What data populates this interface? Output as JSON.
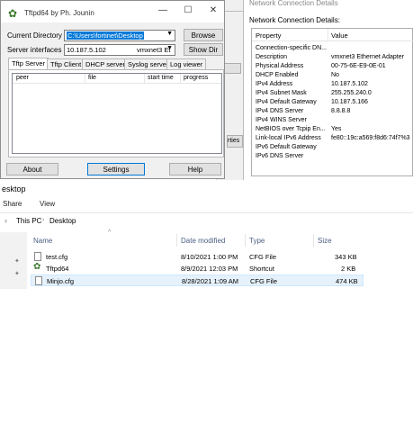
{
  "tftpd": {
    "title": "Tftpd64 by Ph. Jounin",
    "controls": {
      "minimize": "—",
      "maximize": "☐",
      "close": "✕"
    },
    "current_directory_label": "Current Directory",
    "current_directory_value": "C:\\Users\\fortinet\\Desktop",
    "browse_label": "Browse",
    "server_interfaces_label": "Server interfaces",
    "server_interface_ip": "10.187.5.102",
    "server_interface_name": "vmxnet3 Et",
    "show_dir_label": "Show Dir",
    "tabs": [
      "Tftp Server",
      "Tftp Client",
      "DHCP server",
      "Syslog server",
      "Log viewer"
    ],
    "columns": [
      "peer",
      "file",
      "start time",
      "progress"
    ],
    "about_label": "About",
    "settings_label": "Settings",
    "help_label": "Help"
  },
  "ncd": {
    "title": "Network Connection Details",
    "subtitle": "Network Connection Details:",
    "col_property": "Property",
    "col_value": "Value",
    "rows": [
      {
        "p": "Connection-specific DN...",
        "v": ""
      },
      {
        "p": "Description",
        "v": "vmxnet3 Ethernet Adapter"
      },
      {
        "p": "Physical Address",
        "v": "00-75-6E-E9-0E-01"
      },
      {
        "p": "DHCP Enabled",
        "v": "No"
      },
      {
        "p": "IPv4 Address",
        "v": "10.187.5.102"
      },
      {
        "p": "IPv4 Subnet Mask",
        "v": "255.255.240.0"
      },
      {
        "p": "IPv4 Default Gateway",
        "v": "10.187.5.166"
      },
      {
        "p": "IPv4 DNS Server",
        "v": "8.8.8.8"
      },
      {
        "p": "IPv4 WINS Server",
        "v": ""
      },
      {
        "p": "NetBIOS over Tcpip En...",
        "v": "Yes"
      },
      {
        "p": "Link-local IPv6 Address",
        "v": "fe80::19c:a569:f8d6:74f7%3"
      },
      {
        "p": "IPv6 Default Gateway",
        "v": ""
      },
      {
        "p": "IPv6 DNS Server",
        "v": ""
      }
    ],
    "behind_button": "rties"
  },
  "explorer": {
    "title": "esktop",
    "menu": [
      "Share",
      "View"
    ],
    "breadcrumb": [
      "This PC",
      "Desktop"
    ],
    "columns": {
      "name": "Name",
      "date": "Date modified",
      "type": "Type",
      "size": "Size"
    },
    "files": [
      {
        "name": "test.cfg",
        "date": "8/10/2021 1:00 PM",
        "type": "CFG File",
        "size": "343 KB"
      },
      {
        "name": "Tftpd64",
        "date": "8/9/2021 12:03 PM",
        "type": "Shortcut",
        "size": "2 KB"
      },
      {
        "name": "Minjo.cfg",
        "date": "8/28/2021 1:09 AM",
        "type": "CFG File",
        "size": "474 KB"
      }
    ]
  }
}
